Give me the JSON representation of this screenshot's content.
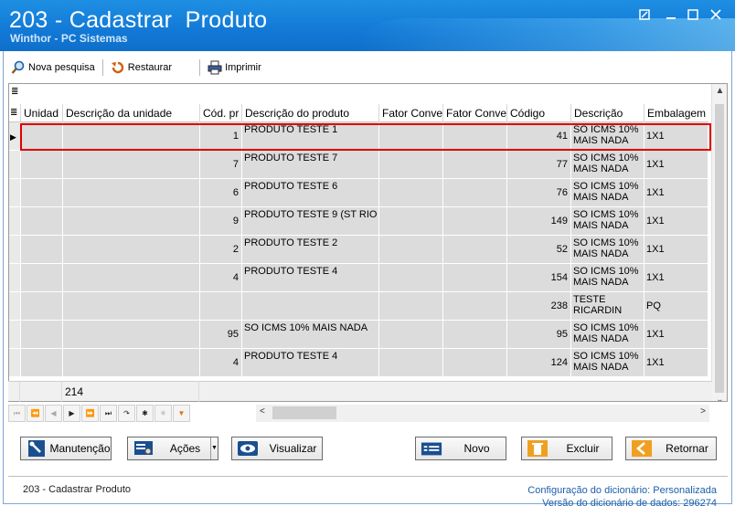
{
  "window": {
    "title": "203 - Cadastrar  Produto",
    "subtitle": "Winthor - PC Sistemas"
  },
  "toolbar": {
    "nova_pesquisa": "Nova pesquisa",
    "restaurar": "Restaurar",
    "imprimir": "Imprimir"
  },
  "grid": {
    "menu_icon": "≣",
    "columns": [
      "Unidad",
      "Descrição da unidade",
      "Cód. pr",
      "Descrição do produto",
      "Fator Conve",
      "Fator Conve",
      "Código",
      "Descrição",
      "Embalagem"
    ],
    "rows": [
      {
        "cod": "1",
        "desc": "PRODUTO TESTE 1",
        "codigo": "41",
        "descricao1": "SO ICMS 10%",
        "descricao2": "MAIS NADA",
        "emb": "1X1"
      },
      {
        "cod": "7",
        "desc": "PRODUTO TESTE 7",
        "codigo": "77",
        "descricao1": "SO ICMS 10%",
        "descricao2": "MAIS NADA",
        "emb": "1X1"
      },
      {
        "cod": "6",
        "desc": "PRODUTO TESTE 6",
        "codigo": "76",
        "descricao1": "SO ICMS 10%",
        "descricao2": "MAIS NADA",
        "emb": "1X1"
      },
      {
        "cod": "9",
        "desc": "PRODUTO TESTE 9 (ST RIO DE",
        "codigo": "149",
        "descricao1": "SO ICMS 10%",
        "descricao2": "MAIS NADA",
        "emb": "1X1"
      },
      {
        "cod": "2",
        "desc": "PRODUTO TESTE 2",
        "codigo": "52",
        "descricao1": "SO ICMS 10%",
        "descricao2": "MAIS NADA",
        "emb": "1X1"
      },
      {
        "cod": "4",
        "desc": "PRODUTO TESTE 4",
        "codigo": "154",
        "descricao1": "SO ICMS 10%",
        "descricao2": "MAIS NADA",
        "emb": "1X1"
      },
      {
        "cod": "",
        "desc": "",
        "codigo": "238",
        "descricao1": "TESTE",
        "descricao2": "RICARDIN",
        "emb": "PQ"
      },
      {
        "cod": "95",
        "desc": "SO ICMS 10% MAIS NADA",
        "codigo": "95",
        "descricao1": "SO ICMS 10%",
        "descricao2": "MAIS NADA",
        "emb": "1X1"
      },
      {
        "cod": "4",
        "desc": "PRODUTO TESTE 4",
        "codigo": "124",
        "descricao1": "SO ICMS 10%",
        "descricao2": "MAIS NADA",
        "emb": "1X1"
      }
    ],
    "footer_count": "214"
  },
  "buttons": {
    "manutencao": "Manutenção",
    "acoes": "Ações",
    "visualizar": "Visualizar",
    "novo": "Novo",
    "excluir": "Excluir",
    "retornar": "Retornar"
  },
  "status": {
    "left": "203 - Cadastrar  Produto",
    "config_label": "Configuração do dicionário:",
    "config_value": "Personalizada",
    "versao_label": "Versão do dicionário de dados:",
    "versao_value": "296274"
  },
  "colors": {
    "title_blue": "#1279d6",
    "selection_red": "#e00000"
  }
}
